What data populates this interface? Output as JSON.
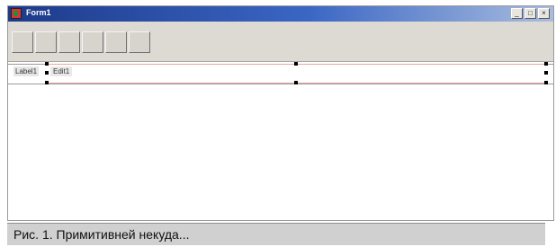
{
  "window": {
    "title": "Form1"
  },
  "caption_buttons": {
    "minimize": "_",
    "maximize": "□",
    "close": "×"
  },
  "toolbar": {
    "button_count": 6
  },
  "form": {
    "field_label": "Label1",
    "field_value": "Edit1"
  },
  "figure_caption": "Рис. 1. Примитивней некуда..."
}
